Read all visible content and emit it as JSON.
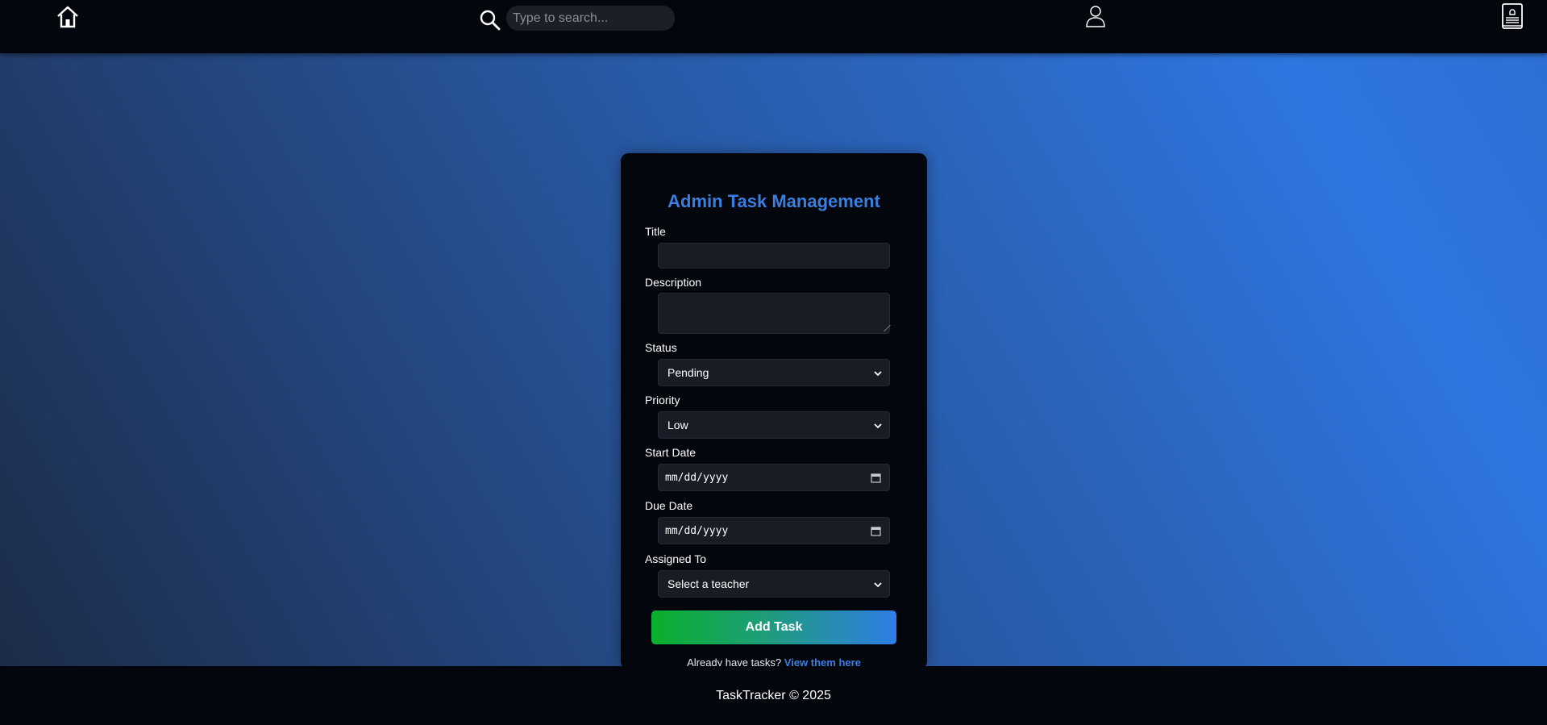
{
  "navbar": {
    "home_icon": "home-icon",
    "search_icon": "search-icon",
    "search_placeholder": "Type to search...",
    "user_icon": "user-icon",
    "notification_icon": "notification-book-icon"
  },
  "form": {
    "title": "Admin Task Management",
    "fields": {
      "title_label": "Title",
      "title_value": "",
      "description_label": "Description",
      "description_value": "",
      "status_label": "Status",
      "status_value": "Pending",
      "priority_label": "Priority",
      "priority_value": "Low",
      "start_date_label": "Start Date",
      "start_date_value": "mm/dd/yyyy",
      "due_date_label": "Due Date",
      "due_date_value": "mm/dd/yyyy",
      "assigned_label": "Assigned To",
      "assigned_value": "Select a teacher"
    },
    "submit_label": "Add Task",
    "footnote_text": "Already have tasks?",
    "footnote_link": "View them here"
  },
  "footer": {
    "text": "TaskTracker © 2025"
  },
  "colors": {
    "accent": "#3a7fe0",
    "nav_bg": "#03060d",
    "button_start": "#09b02c",
    "button_end": "#2e7ee6"
  }
}
